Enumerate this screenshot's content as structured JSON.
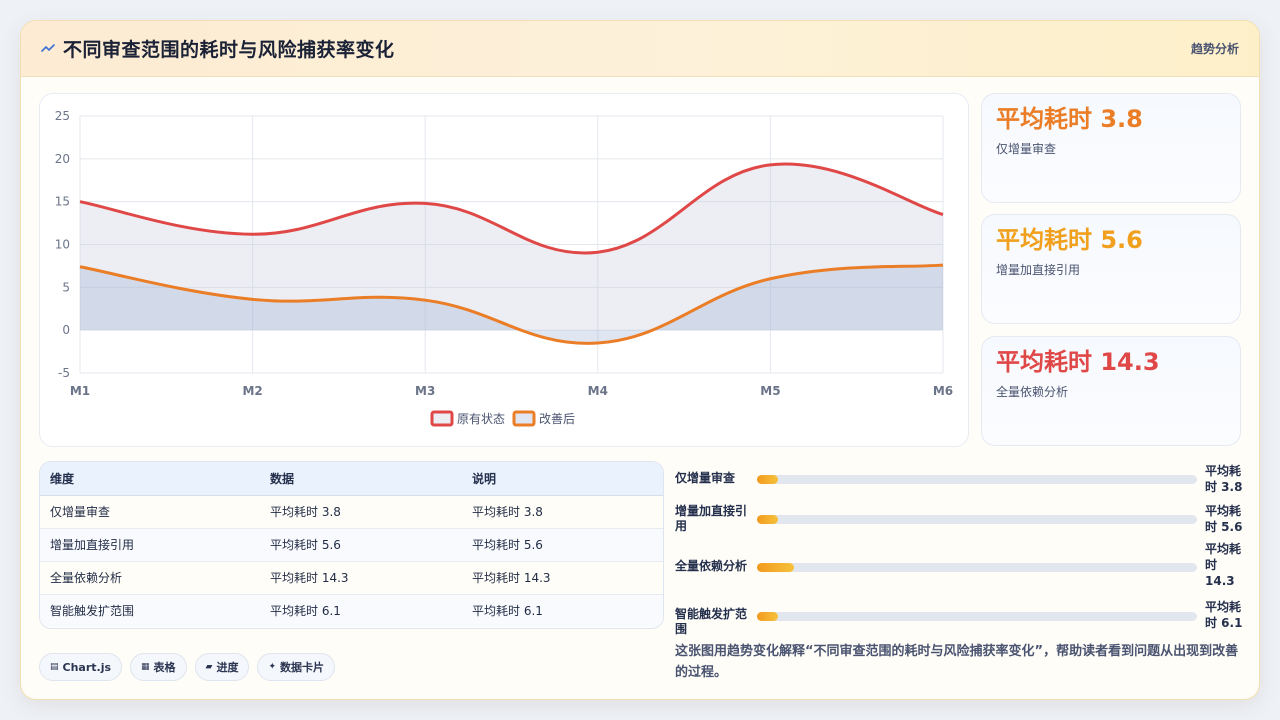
{
  "header": {
    "title": "不同审查范围的耗时与风险捕获率变化",
    "tag": "趋势分析"
  },
  "chart_data": {
    "type": "line",
    "categories": [
      "M1",
      "M2",
      "M3",
      "M4",
      "M5",
      "M6"
    ],
    "ylim": [
      -5,
      25
    ],
    "yticks": [
      25,
      20,
      15,
      10,
      5,
      0,
      -5
    ],
    "grid": true,
    "legend_position": "bottom",
    "series": [
      {
        "name": "原有状态",
        "values": [
          15,
          11.2,
          14.8,
          9.1,
          19.3,
          13.5
        ],
        "color": "#e04848",
        "fill": "rgba(200,205,220,0.35)"
      },
      {
        "name": "改善后",
        "values": [
          7.4,
          3.6,
          3.5,
          -1.5,
          6,
          7.6
        ],
        "color": "#ea7d26",
        "fill": "rgba(150,170,210,0.30)"
      }
    ]
  },
  "stats": [
    {
      "value": "平均耗时 3.8",
      "label": "仅增量审查",
      "color": "#ea7d26"
    },
    {
      "value": "平均耗时 5.6",
      "label": "增量加直接引用",
      "color": "#f0a01c"
    },
    {
      "value": "平均耗时 14.3",
      "label": "全量依赖分析",
      "color": "#e04848"
    }
  ],
  "table": {
    "headers": [
      "维度",
      "数据",
      "说明"
    ],
    "rows": [
      [
        "仅增量审查",
        "平均耗时 3.8",
        "平均耗时 3.8"
      ],
      [
        "增量加直接引用",
        "平均耗时 5.6",
        "平均耗时 5.6"
      ],
      [
        "全量依赖分析",
        "平均耗时 14.3",
        "平均耗时 14.3"
      ],
      [
        "智能触发扩范围",
        "平均耗时 6.1",
        "平均耗时 6.1"
      ]
    ]
  },
  "progress": [
    {
      "label": "仅增量审查",
      "value": "平均耗时 3.8",
      "fraction": 0.048
    },
    {
      "label": "增量加直接引用",
      "value": "平均耗时 5.6",
      "fraction": 0.048
    },
    {
      "label": "全量依赖分析",
      "value": "平均耗时 14.3",
      "fraction": 0.084
    },
    {
      "label": "智能触发扩范围",
      "value": "平均耗时 6.1",
      "fraction": 0.048
    }
  ],
  "chips": [
    {
      "icon": "chart-icon",
      "label": "Chart.js"
    },
    {
      "icon": "table-icon",
      "label": "表格"
    },
    {
      "icon": "progress-icon",
      "label": "进度"
    },
    {
      "icon": "sparkle-icon",
      "label": "数据卡片"
    }
  ],
  "description": "这张图用趋势变化解释“不同审查范围的耗时与风险捕获率变化”，帮助读者看到问题从出现到改善的过程。"
}
